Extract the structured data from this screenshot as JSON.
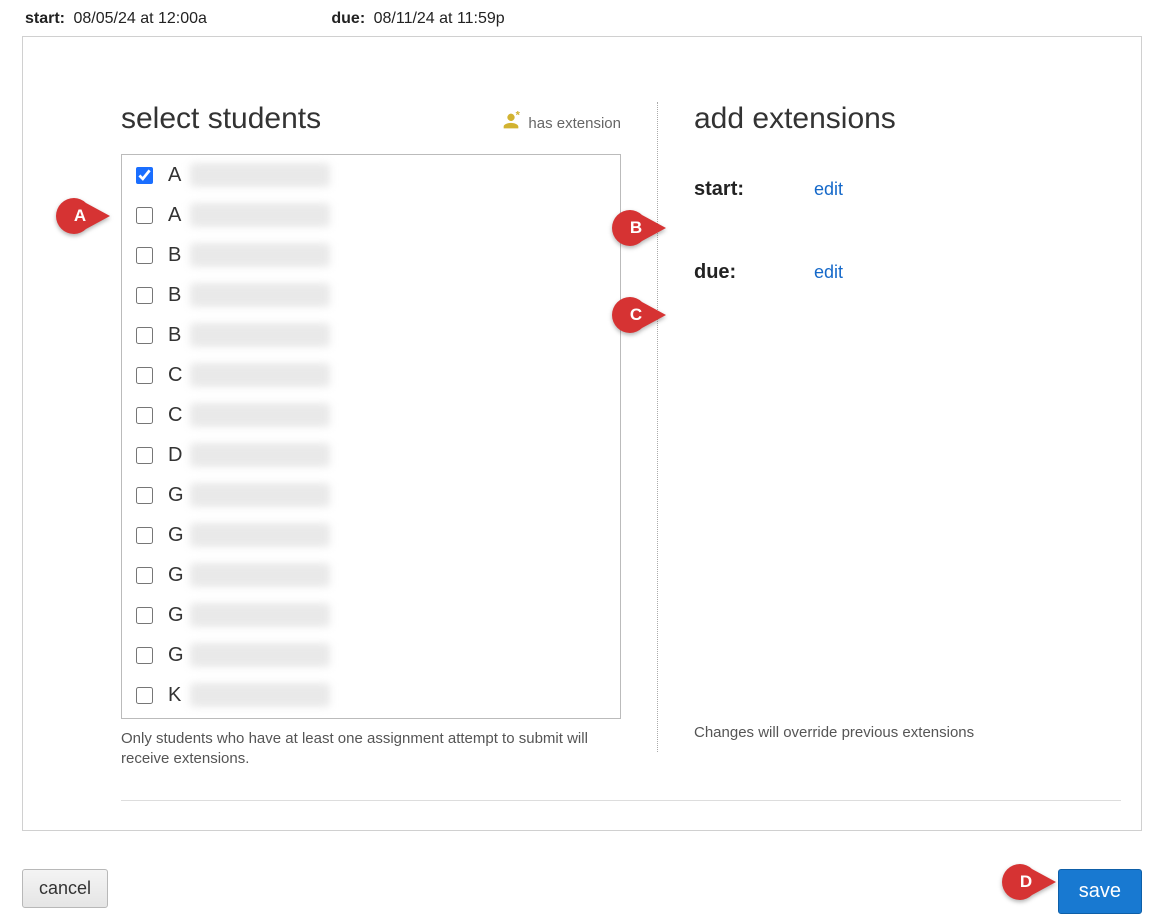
{
  "top": {
    "start_label": "start:",
    "start_value": "08/05/24 at 12:00a",
    "due_label": "due:",
    "due_value": "08/11/24 at 11:59p"
  },
  "left": {
    "heading": "select students",
    "legend_text": "has extension",
    "note": "Only students who have at least one assignment attempt to submit will receive extensions.",
    "students": [
      {
        "initial": "A",
        "checked": true
      },
      {
        "initial": "A",
        "checked": false
      },
      {
        "initial": "B",
        "checked": false
      },
      {
        "initial": "B",
        "checked": false
      },
      {
        "initial": "B",
        "checked": false
      },
      {
        "initial": "C",
        "checked": false
      },
      {
        "initial": "C",
        "checked": false
      },
      {
        "initial": "D",
        "checked": false
      },
      {
        "initial": "G",
        "checked": false
      },
      {
        "initial": "G",
        "checked": false
      },
      {
        "initial": "G",
        "checked": false
      },
      {
        "initial": "G",
        "checked": false
      },
      {
        "initial": "G",
        "checked": false
      },
      {
        "initial": "K",
        "checked": false
      }
    ]
  },
  "right": {
    "heading": "add extensions",
    "start_label": "start:",
    "start_edit": "edit",
    "due_label": "due:",
    "due_edit": "edit",
    "override_note": "Changes will override previous extensions"
  },
  "buttons": {
    "cancel": "cancel",
    "save": "save"
  },
  "callouts": {
    "A": "A",
    "B": "B",
    "C": "C",
    "D": "D"
  }
}
